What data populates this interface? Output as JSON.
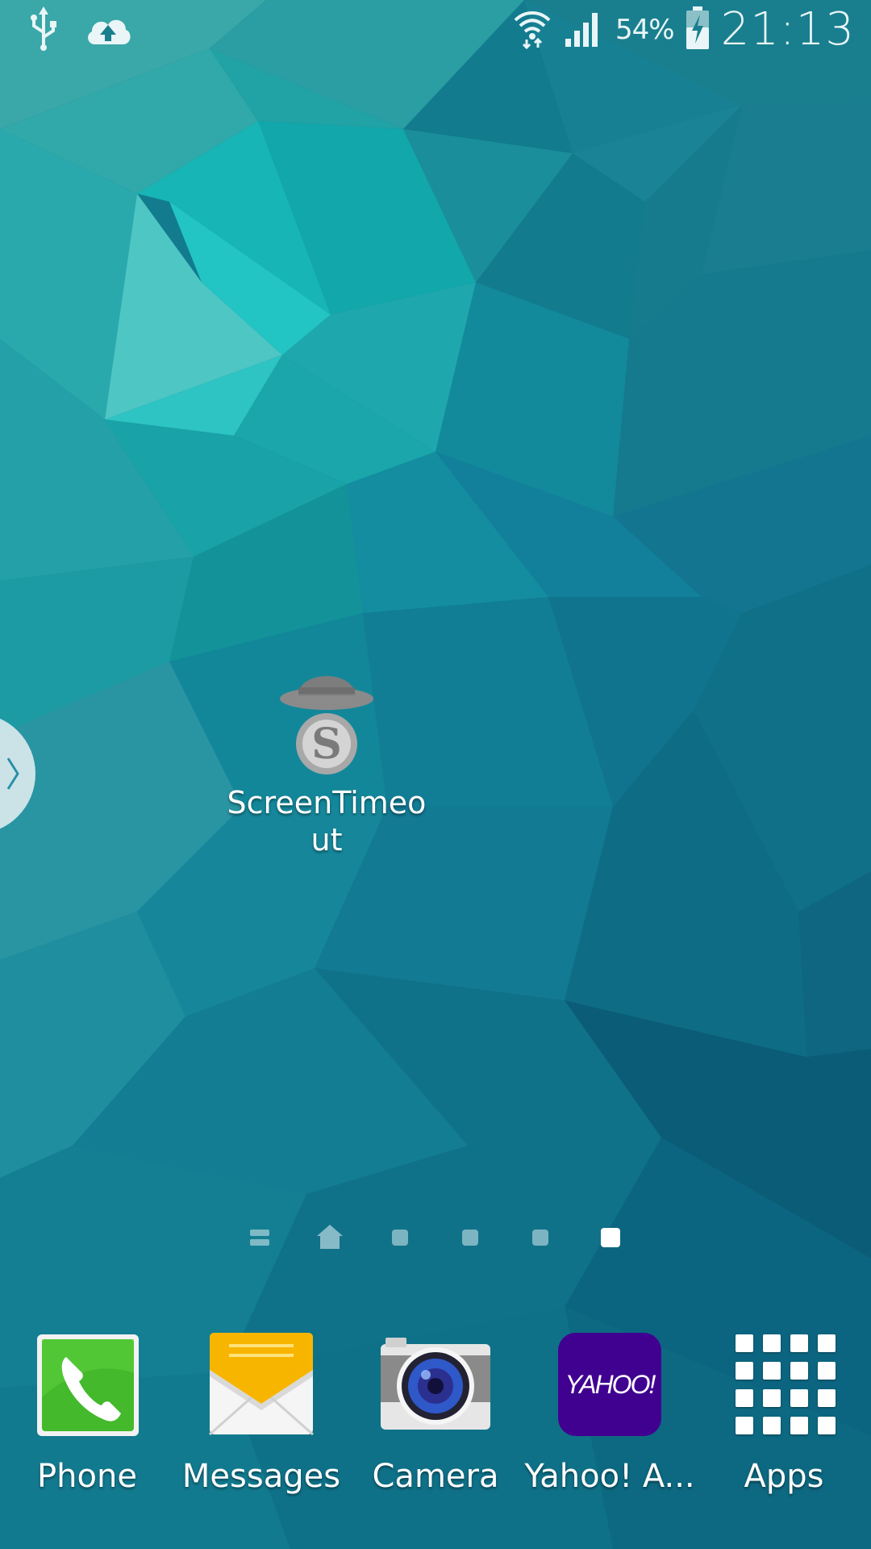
{
  "status_bar": {
    "icons": [
      "usb-icon",
      "cloud-upload-icon",
      "wifi-icon",
      "signal-icon",
      "battery-charging-icon"
    ],
    "battery_percent": "54%",
    "time": "21:13"
  },
  "desktop": {
    "apps": [
      {
        "label": "ScreenTimeout",
        "icon": "screentimeout-app-icon"
      }
    ]
  },
  "page_indicator": {
    "items": [
      "menu-page",
      "home-page",
      "page-3",
      "page-4",
      "page-5",
      "page-6"
    ],
    "active_index": 5
  },
  "dock": {
    "items": [
      {
        "label": "Phone",
        "icon": "phone-icon"
      },
      {
        "label": "Messages",
        "icon": "messages-icon"
      },
      {
        "label": "Camera",
        "icon": "camera-icon"
      },
      {
        "label": "Yahoo! A...",
        "icon": "yahoo-icon",
        "icon_text": "YAHOO!"
      },
      {
        "label": "Apps",
        "icon": "apps-grid-icon"
      }
    ]
  },
  "colors": {
    "wallpaper_base": "#137f93",
    "yahoo_purple": "#400191",
    "phone_green": "#3fbf2a",
    "messages_yellow": "#f7b500"
  }
}
